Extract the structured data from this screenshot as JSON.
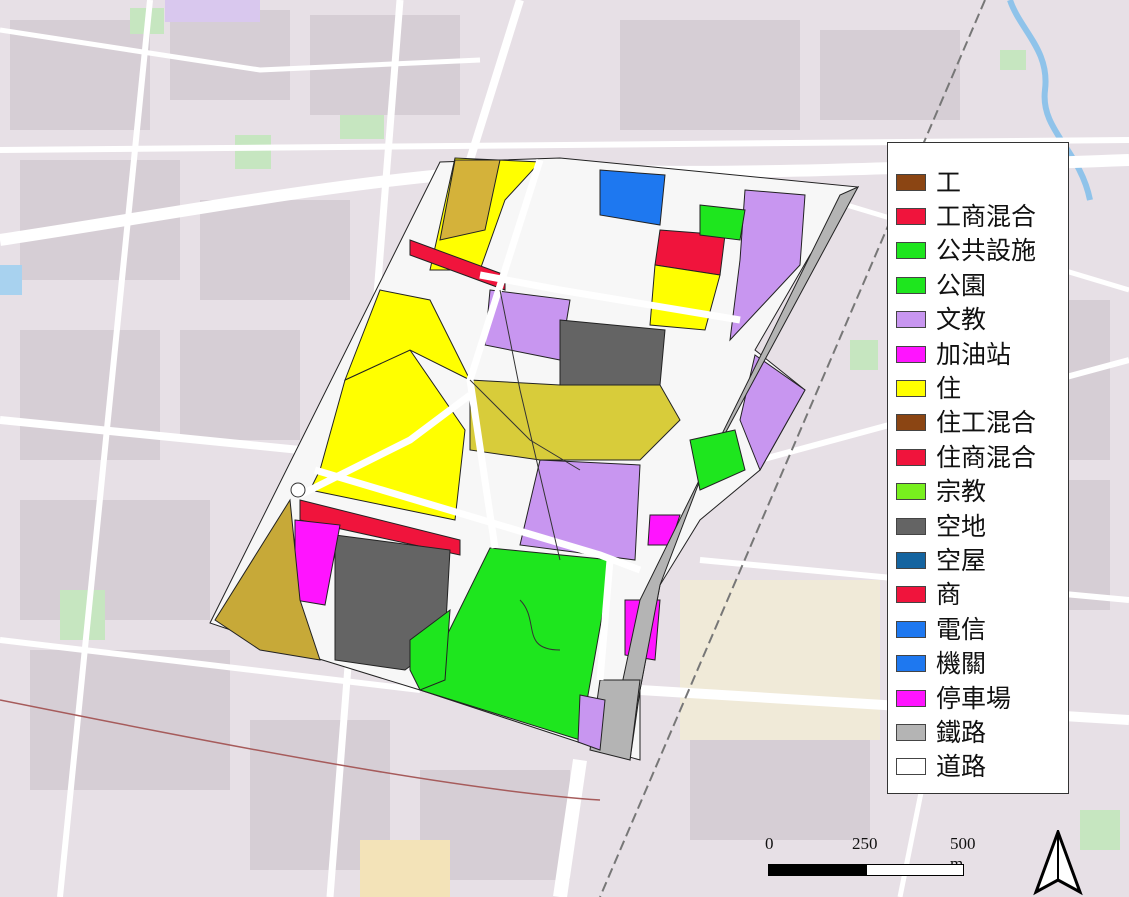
{
  "legend": {
    "items": [
      {
        "label": "工",
        "color": "#8b4513"
      },
      {
        "label": "工商混合",
        "color": "#f0143c"
      },
      {
        "label": "公共設施",
        "color": "#1ee61e"
      },
      {
        "label": "公園",
        "color": "#1ee61e"
      },
      {
        "label": "文教",
        "color": "#c896f0"
      },
      {
        "label": "加油站",
        "color": "#ff14ff"
      },
      {
        "label": "住",
        "color": "#ffff00"
      },
      {
        "label": "住工混合",
        "color": "#8b4513"
      },
      {
        "label": "住商混合",
        "color": "#f0143c"
      },
      {
        "label": "宗教",
        "color": "#78f01e"
      },
      {
        "label": "空地",
        "color": "#646464"
      },
      {
        "label": "空屋",
        "color": "#1464a0"
      },
      {
        "label": "商",
        "color": "#f0143c"
      },
      {
        "label": "電信",
        "color": "#1e78f0"
      },
      {
        "label": "機關",
        "color": "#1e78f0"
      },
      {
        "label": "停車場",
        "color": "#ff14ff"
      },
      {
        "label": "鐵路",
        "color": "#b4b4b4"
      },
      {
        "label": "道路",
        "color": "#ffffff"
      }
    ]
  },
  "scalebar": {
    "label_0": "0",
    "label_250": "250",
    "label_500": "500 m"
  },
  "map_colors": {
    "basemap": "#e7e0e6",
    "street": "#ffffff",
    "block": "#d5cdd4",
    "railway": "#bdbdbd"
  }
}
